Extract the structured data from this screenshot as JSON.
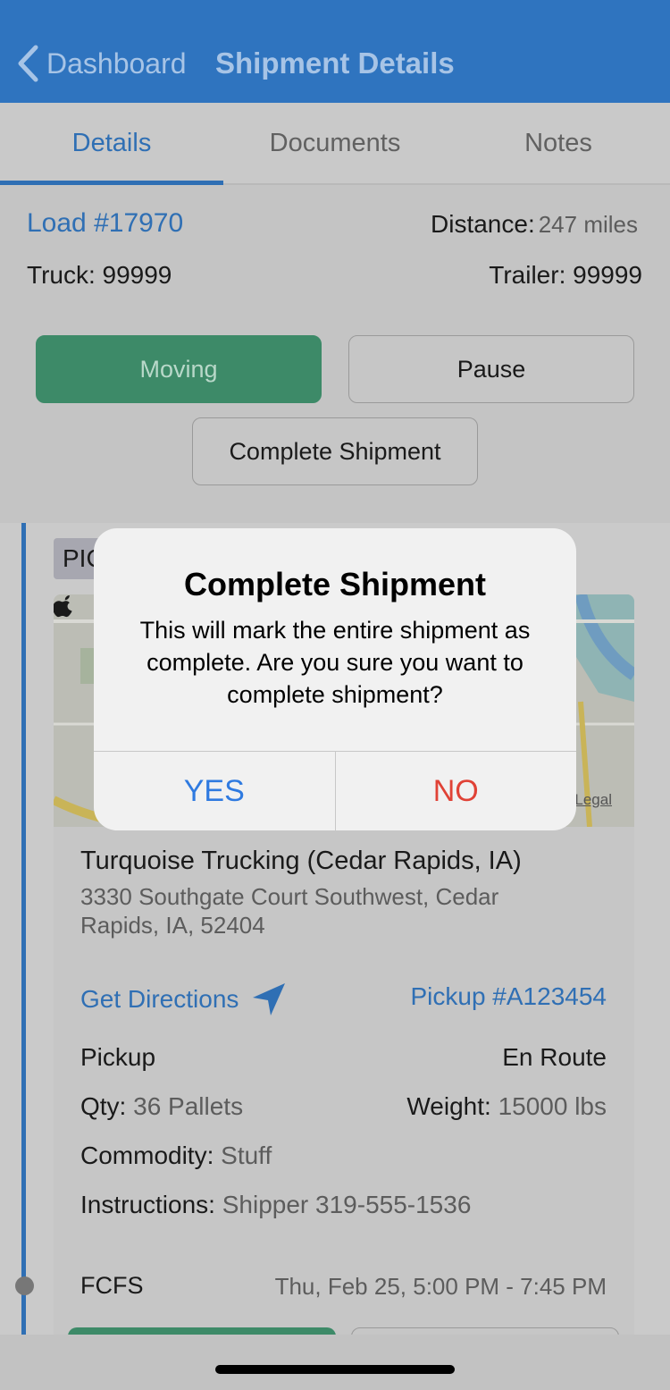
{
  "nav": {
    "back_label": "Dashboard",
    "title": "Shipment Details"
  },
  "tabs": [
    {
      "label": "Details",
      "active": true
    },
    {
      "label": "Documents",
      "active": false
    },
    {
      "label": "Notes",
      "active": false
    }
  ],
  "summary": {
    "load": "Load #17970",
    "distance_label": "Distance:",
    "distance_value": "247 miles",
    "truck": "Truck: 99999",
    "trailer": "Trailer: 99999"
  },
  "actions": {
    "moving": "Moving",
    "pause": "Pause",
    "complete": "Complete Shipment"
  },
  "stop": {
    "badge": "PIC",
    "map_legal": "Legal",
    "shipper": "Turquoise Trucking (Cedar Rapids, IA)",
    "address": "3330 Southgate Court Southwest, Cedar Rapids, IA, 52404",
    "directions": "Get Directions",
    "pickup_number": "Pickup #A123454",
    "type": "Pickup",
    "status": "En Route",
    "qty_label": "Qty:",
    "qty_value": "36 Pallets",
    "weight_label": "Weight:",
    "weight_value": "15000 lbs",
    "commodity_label": "Commodity:",
    "commodity_value": "Stuff",
    "instructions_label": "Instructions:",
    "instructions_value": "Shipper 319-555-1536",
    "schedule_type": "FCFS",
    "window": "Thu, Feb 25, 5:00 PM - 7:45 PM"
  },
  "dialog": {
    "title": "Complete Shipment",
    "message": "This will mark the entire shipment as complete. Are you sure you want to complete shipment?",
    "yes": "YES",
    "no": "NO"
  },
  "colors": {
    "header": "#2f74bf",
    "accent_blue": "#2f6fb4",
    "moving_green": "#3d8a68",
    "yes_blue": "#2f7ae0",
    "no_red": "#e04236"
  },
  "icons": [
    "chevron-left-icon",
    "location-arrow-icon",
    "apple-maps-icon"
  ]
}
